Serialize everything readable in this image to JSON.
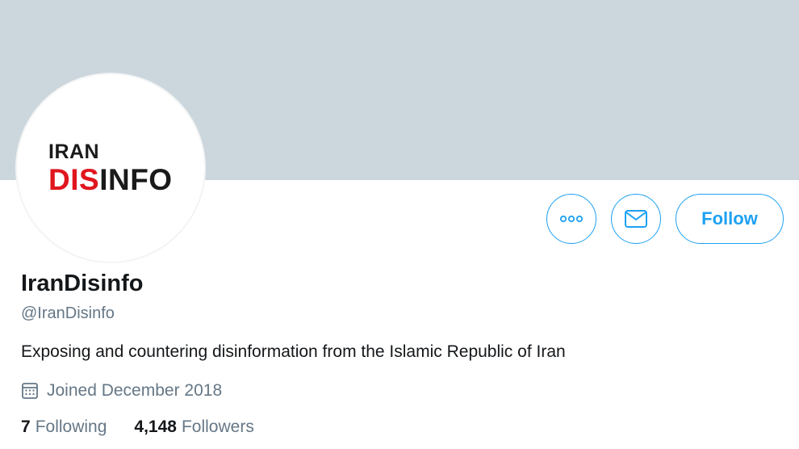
{
  "profile": {
    "avatar_logo": {
      "line1": "IRAN",
      "line2_red": "DIS",
      "line2_black": "INFO"
    },
    "display_name": "IranDisinfo",
    "handle": "@IranDisinfo",
    "bio": "Exposing and countering disinformation from the Islamic Republic of Iran",
    "joined": "Joined December 2018"
  },
  "actions": {
    "more_icon": "more-icon",
    "message_icon": "envelope-icon",
    "follow_label": "Follow"
  },
  "stats": {
    "following_count": "7",
    "following_label": "Following",
    "followers_count": "4,148",
    "followers_label": "Followers"
  },
  "colors": {
    "banner": "#ccd6dd",
    "accent": "#1da1f2",
    "logo_red": "#e0161e",
    "secondary_text": "#657786"
  }
}
